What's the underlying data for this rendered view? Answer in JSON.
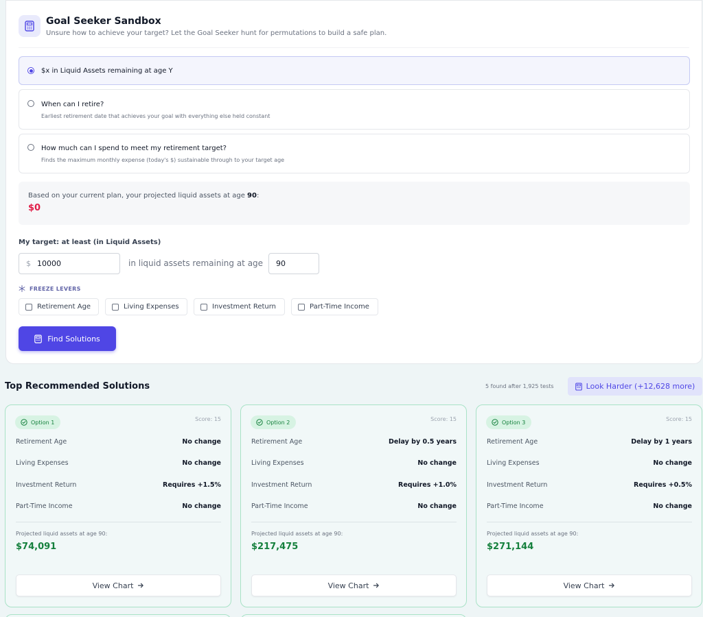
{
  "header": {
    "title": "Goal Seeker Sandbox",
    "subtitle": "Unsure how to achieve your target? Let the Goal Seeker hunt for permutations to build a safe plan."
  },
  "modes": [
    {
      "label": "$x in Liquid Assets remaining at age Y",
      "description": "",
      "selected": true
    },
    {
      "label": "When can I retire?",
      "description": "Earliest retirement date that achieves your goal with everything else held constant",
      "selected": false
    },
    {
      "label": "How much can I spend to meet my retirement target?",
      "description": "Finds the maximum monthly expense (today's $) sustainable through to your target age",
      "selected": false
    }
  ],
  "projection": {
    "text": "Based on your current plan, your projected liquid assets at age",
    "age": "90",
    "suffix": ":",
    "value": "$0"
  },
  "target": {
    "label": "My target: at least (in Liquid Assets)",
    "currency": "$",
    "amount": "10000",
    "middle_text": "in liquid assets remaining at age",
    "age": "90"
  },
  "freeze": {
    "title": "FREEZE LEVERS",
    "levers": [
      "Retirement Age",
      "Living Expenses",
      "Investment Return",
      "Part-Time Income"
    ]
  },
  "find_button": "Find Solutions",
  "solutions": {
    "title": "Top Recommended Solutions",
    "meta": "5 found after 1,925 tests",
    "look_harder": "Look Harder (+12,628 more)",
    "projected_label": "Projected liquid assets at age 90:",
    "view_chart": "View Chart",
    "row_labels": [
      "Retirement Age",
      "Living Expenses",
      "Investment Return",
      "Part-Time Income"
    ],
    "cards": [
      {
        "option": "Option 1",
        "score": "Score: 15",
        "values": [
          "No change",
          "No change",
          "Requires +1.5%",
          "No change"
        ],
        "projected": "$74,091"
      },
      {
        "option": "Option 2",
        "score": "Score: 15",
        "values": [
          "Delay by 0.5 years",
          "No change",
          "Requires +1.0%",
          "No change"
        ],
        "projected": "$217,475"
      },
      {
        "option": "Option 3",
        "score": "Score: 15",
        "values": [
          "Delay by 1 years",
          "No change",
          "Requires +0.5%",
          "No change"
        ],
        "projected": "$271,144"
      }
    ]
  },
  "colors": {
    "accent": "#4f46e5",
    "positive": "#15803d",
    "negative": "#e11d48"
  },
  "icons": {
    "header": "calculator-icon",
    "freeze": "snowflake-icon",
    "badge": "check-circle-icon",
    "chart": "arrow-right-icon"
  }
}
